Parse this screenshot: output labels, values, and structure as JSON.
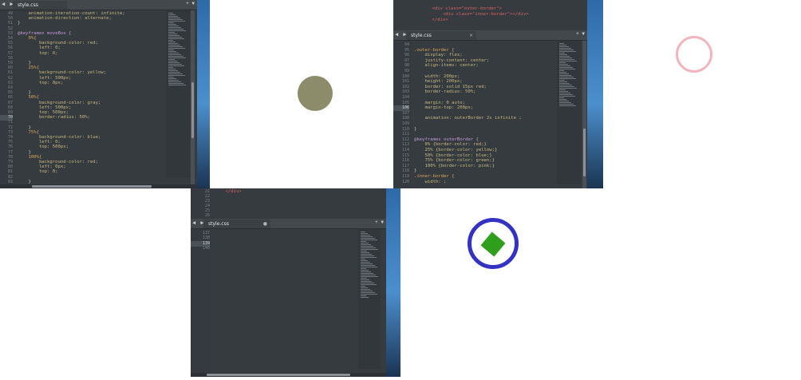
{
  "panel1": {
    "tab_label": "style.css",
    "nav_arrows": "◀ ▶",
    "controls": "+ ▼",
    "lines": [
      {
        "n": "49",
        "t": "    animation-iteration-count: infinite;"
      },
      {
        "n": "50",
        "t": "    animation-direction: alternate;"
      },
      {
        "n": "51",
        "t": "}"
      },
      {
        "n": "52",
        "t": ""
      },
      {
        "n": "53",
        "t": "@keyframes moveBox {"
      },
      {
        "n": "54",
        "t": "    0%{"
      },
      {
        "n": "55",
        "t": "        background-color: red;"
      },
      {
        "n": "56",
        "t": "        left: 0;"
      },
      {
        "n": "57",
        "t": "        top: 0;"
      },
      {
        "n": "58",
        "t": ""
      },
      {
        "n": "59",
        "t": "    }"
      },
      {
        "n": "60",
        "t": "    25%{"
      },
      {
        "n": "61",
        "t": "        background-color: yellow;"
      },
      {
        "n": "62",
        "t": "        left: 500px;"
      },
      {
        "n": "63",
        "t": "        top: 0px;"
      },
      {
        "n": "64",
        "t": ""
      },
      {
        "n": "65",
        "t": "    }"
      },
      {
        "n": "66",
        "t": "    50%{"
      },
      {
        "n": "67",
        "t": "        background-color: gray;"
      },
      {
        "n": "68",
        "t": "        left: 500px;"
      },
      {
        "n": "69",
        "t": "        top: 500px;"
      },
      {
        "n": "70",
        "t": "        border-radius: 50%;"
      },
      {
        "n": "71",
        "t": ""
      },
      {
        "n": "72",
        "t": "    }"
      },
      {
        "n": "73",
        "t": "    75%{"
      },
      {
        "n": "74",
        "t": "        background-color: blue;"
      },
      {
        "n": "75",
        "t": "        left: 0;"
      },
      {
        "n": "76",
        "t": "        top: 500px;"
      },
      {
        "n": "77",
        "t": "    }"
      },
      {
        "n": "78",
        "t": "    100%{"
      },
      {
        "n": "79",
        "t": "        background-color: red;"
      },
      {
        "n": "80",
        "t": "        left: 0px;"
      },
      {
        "n": "81",
        "t": "        top: 0;"
      },
      {
        "n": "82",
        "t": ""
      },
      {
        "n": "83",
        "t": "    }"
      }
    ],
    "current_line": "70"
  },
  "panel2": {
    "top_lines": [
      {
        "n": "",
        "t": "    <div class=\"outer-border\">"
      },
      {
        "n": "",
        "t": "        <div class=\"inner-border\"></div>"
      },
      {
        "n": "",
        "t": "    </div>"
      }
    ],
    "tab_label": "style.css",
    "tab_close": "×",
    "nav_arrows": "◀ ▶",
    "controls": "+ ▼",
    "lines": [
      {
        "n": "94",
        "t": ""
      },
      {
        "n": "95",
        "t": ".outer-border {"
      },
      {
        "n": "96",
        "t": "    display: flex;"
      },
      {
        "n": "97",
        "t": "    justify-content: center;"
      },
      {
        "n": "98",
        "t": "    align-items: center;"
      },
      {
        "n": "99",
        "t": ""
      },
      {
        "n": "100",
        "t": "    width: 200px;"
      },
      {
        "n": "101",
        "t": "    height: 200px;"
      },
      {
        "n": "102",
        "t": "    border: solid 15px red;"
      },
      {
        "n": "103",
        "t": "    border-radius: 50%;"
      },
      {
        "n": "104",
        "t": ""
      },
      {
        "n": "105",
        "t": "    margin: 0 auto;"
      },
      {
        "n": "106",
        "t": "    margin-top: 200px;"
      },
      {
        "n": "107",
        "t": ""
      },
      {
        "n": "108",
        "t": "    animation: outerBorder 2s infinite ;"
      },
      {
        "n": "109",
        "t": ""
      },
      {
        "n": "110",
        "t": "}"
      },
      {
        "n": "111",
        "t": ""
      },
      {
        "n": "112",
        "t": "@keyframes outerBorder {"
      },
      {
        "n": "113",
        "t": "    0% {border-color: red;}"
      },
      {
        "n": "114",
        "t": "    25% {border-color: yellow;}"
      },
      {
        "n": "115",
        "t": "    50% {border-color: blue;}"
      },
      {
        "n": "116",
        "t": "    75% {border-color: green;}"
      },
      {
        "n": "117",
        "t": "    100% {border-color: pink;}"
      },
      {
        "n": "118",
        "t": "}"
      },
      {
        "n": "119",
        "t": ".inner-border {"
      },
      {
        "n": "120",
        "t": "    width: ;"
      }
    ],
    "current_line": "106"
  },
  "panel3": {
    "top_lines": [
      {
        "n": "21",
        "t": "    </div>"
      },
      {
        "n": "22",
        "t": ""
      },
      {
        "n": "23",
        "t": ""
      },
      {
        "n": "24",
        "t": ""
      },
      {
        "n": "25",
        "t": ""
      },
      {
        "n": "26",
        "t": ""
      }
    ],
    "tab_label": "style.css",
    "tab_dot": "●",
    "nav_arrows": "◀ ▶",
    "controls": "+ ▼",
    "lines": [
      {
        "n": "137",
        "t": ""
      },
      {
        "n": "138",
        "t": ""
      },
      {
        "n": "139",
        "t": ""
      },
      {
        "n": "140",
        "t": ""
      }
    ],
    "current_line": "139"
  },
  "colors": {
    "editor_bg": "#363b40",
    "olive_circle": "#8c8c6a",
    "pink_ring": "#f1b6bd",
    "blue_ring": "#3332c4",
    "green_square": "#2f9e1c"
  }
}
